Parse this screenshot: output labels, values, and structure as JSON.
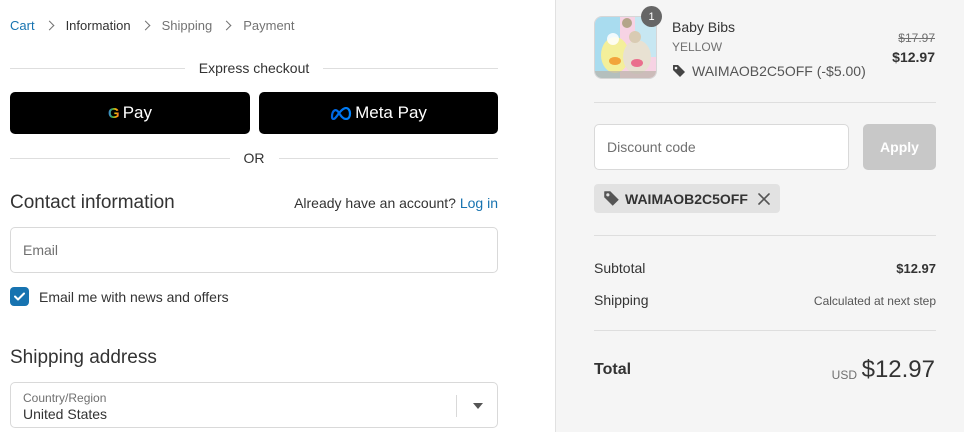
{
  "breadcrumb": {
    "items": [
      "Cart",
      "Information",
      "Shipping",
      "Payment"
    ]
  },
  "express": {
    "title": "Express checkout",
    "gpay_g": "G",
    "gpay_label": "Pay",
    "metapay_label": "Meta Pay",
    "or_label": "OR"
  },
  "contact": {
    "title": "Contact information",
    "account_prompt": "Already have an account?",
    "login_label": "Log in",
    "email_placeholder": "Email",
    "newsletter_label": "Email me with news and offers",
    "newsletter_checked": true
  },
  "shipping": {
    "title": "Shipping address",
    "country_label": "Country/Region",
    "country_value": "United States"
  },
  "order": {
    "quantity": "1",
    "product_name": "Baby Bibs",
    "variant": "YELLOW",
    "discount_line": "WAIMAOB2C5OFF (-$5.00)",
    "price_original": "$17.97",
    "price_current": "$12.97",
    "discount_placeholder": "Discount code",
    "apply_label": "Apply",
    "applied_code": "WAIMAOB2C5OFF",
    "subtotal_label": "Subtotal",
    "subtotal_value": "$12.97",
    "shipping_label": "Shipping",
    "shipping_value": "Calculated at next step",
    "total_label": "Total",
    "total_currency": "USD",
    "total_value": "$12.97"
  },
  "colors": {
    "link": "#1773b0",
    "button_dark": "#000000",
    "apply_disabled": "#c8c8c8",
    "sidebar_bg": "#f5f5f5"
  },
  "icons": [
    "chevron-right-icon",
    "google-g-icon",
    "meta-logo-icon",
    "checkmark-icon",
    "dropdown-caret-icon",
    "tag-icon",
    "close-icon"
  ]
}
